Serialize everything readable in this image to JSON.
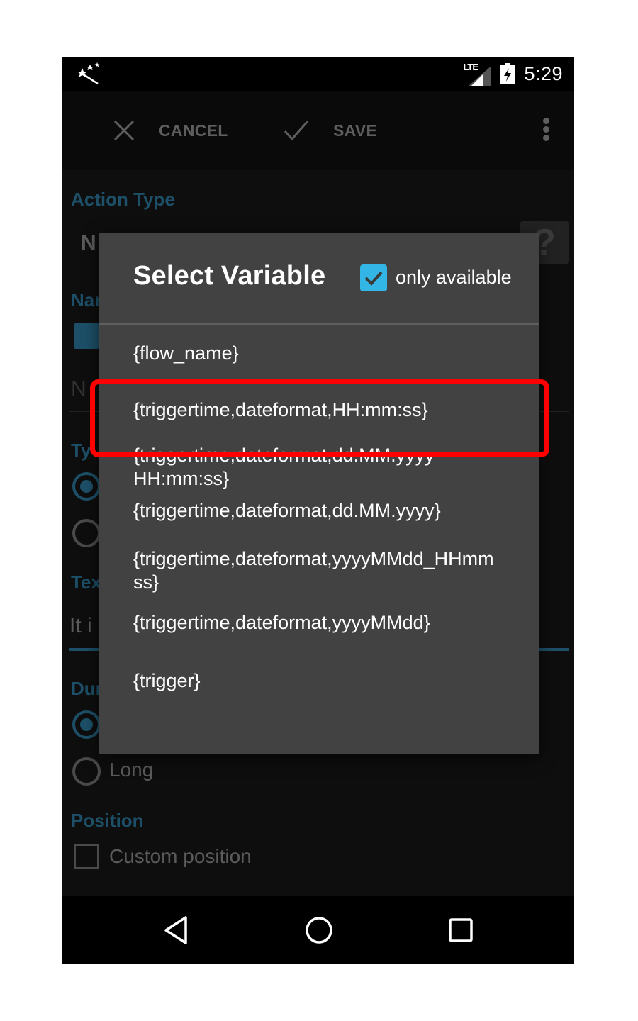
{
  "status_bar": {
    "notification_icon": "magic-wand-icon",
    "network_label": "LTE",
    "signal_icon": "signal-icon",
    "battery_icon": "battery-charging-icon",
    "time": "5:29"
  },
  "toolbar": {
    "cancel_label": "CANCEL",
    "cancel_icon": "close-icon",
    "save_label": "SAVE",
    "save_icon": "check-icon",
    "more_icon": "more-vertical-icon"
  },
  "form": {
    "action_type_label": "Action Type",
    "action_type_value": "N",
    "help_label": "?",
    "name_label": "Nar",
    "name_placeholder": "N",
    "type_label": "Ty",
    "text_label": "Tex",
    "text_value": "It i",
    "duration_label": "Dur",
    "duration_long_label": "Long",
    "position_label": "Position",
    "custom_position_label": "Custom position"
  },
  "dialog": {
    "title": "Select Variable",
    "only_available_label": "only available",
    "only_available_checked": true,
    "variables": [
      "{flow_name}",
      "{triggertime,dateformat,HH:mm:ss}",
      "{triggertime,dateformat,dd.MM.yyyy HH:mm:ss}",
      "{triggertime,dateformat,dd.MM.yyyy}",
      "{triggertime,dateformat,yyyyMMdd_HHmmss}",
      "{triggertime,dateformat,yyyyMMdd}",
      "{trigger}"
    ],
    "highlighted_index": 1
  },
  "colors": {
    "accent": "#33b5e5",
    "dim_accent": "#1d5068",
    "dialog_bg": "#424242",
    "highlight": "#ff0000"
  },
  "navigation": {
    "back_icon": "back-icon",
    "home_icon": "home-icon",
    "recents_icon": "recents-icon"
  }
}
